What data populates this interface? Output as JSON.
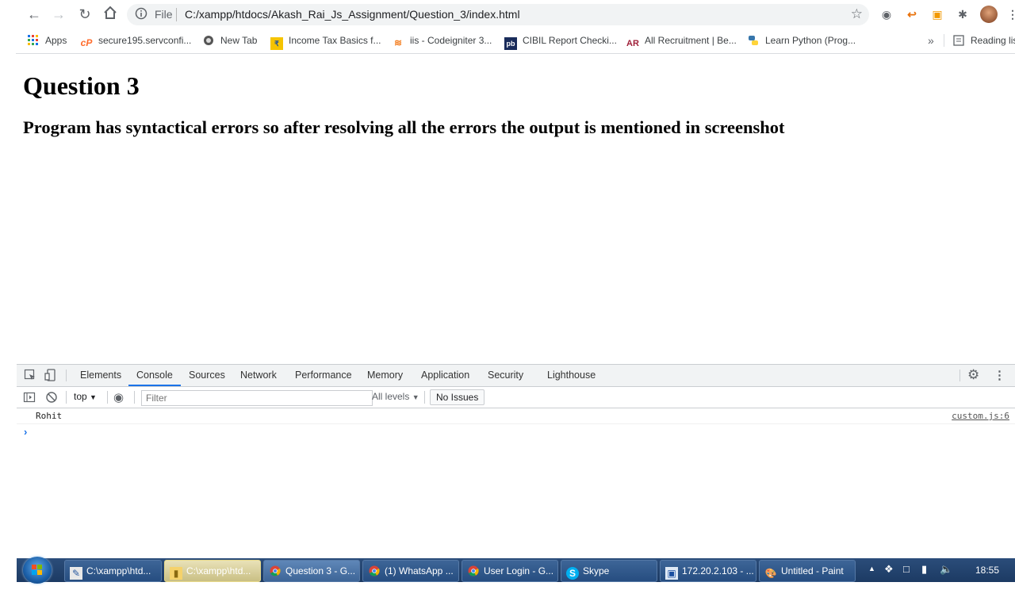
{
  "browser": {
    "omnibox": {
      "scheme_label": "File",
      "url": "C:/xampp/htdocs/Akash_Rai_Js_Assignment/Question_3/index.html"
    },
    "bookmarks": [
      {
        "label": "Apps",
        "icon": "apps-grid-icon"
      },
      {
        "label": "secure195.servconfi...",
        "icon": "cpanel-icon"
      },
      {
        "label": "New Tab",
        "icon": "new-tab-icon"
      },
      {
        "label": "Income Tax Basics f...",
        "icon": "income-tax-icon"
      },
      {
        "label": "iis - Codeigniter 3...",
        "icon": "stackoverflow-icon"
      },
      {
        "label": "CIBIL Report Checki...",
        "icon": "cibil-icon"
      },
      {
        "label": "All Recruitment | Be...",
        "icon": "recruitment-icon"
      },
      {
        "label": "Learn Python (Prog...",
        "icon": "python-icon"
      }
    ],
    "bookmarks_overflow": "»",
    "reading_list": "Reading list"
  },
  "page": {
    "heading": "Question 3",
    "subheading": "Program has syntactical errors so after resolving all the errors the output is mentioned in screenshot"
  },
  "devtools": {
    "tabs": [
      "Elements",
      "Console",
      "Sources",
      "Network",
      "Performance",
      "Memory",
      "Application",
      "Security",
      "Lighthouse"
    ],
    "active_tab": "Console",
    "context": "top",
    "filter_placeholder": "Filter",
    "levels": "All levels",
    "issues": "No Issues",
    "console_message": "Rohit",
    "console_source": "custom.js:6",
    "prompt": "›"
  },
  "taskbar": {
    "items": [
      {
        "label": "C:\\xampp\\htd...",
        "icon": "notepad-icon",
        "active": false
      },
      {
        "label": "C:\\xampp\\htd...",
        "icon": "folder-icon",
        "active": true
      },
      {
        "label": "Question 3 - G...",
        "icon": "chrome-icon",
        "active": false
      },
      {
        "label": "(1) WhatsApp ...",
        "icon": "chrome-icon",
        "active": false
      },
      {
        "label": "User Login - G...",
        "icon": "chrome-icon",
        "active": false
      },
      {
        "label": "Skype",
        "icon": "skype-icon",
        "active": false
      },
      {
        "label": "172.20.2.103 - ...",
        "icon": "remote-desktop-icon",
        "active": false
      },
      {
        "label": "Untitled - Paint",
        "icon": "paint-icon",
        "active": false
      }
    ],
    "clock": "18:55"
  },
  "colors": {
    "accent": "#1a73e8",
    "taskbar": "#1c3a63"
  }
}
